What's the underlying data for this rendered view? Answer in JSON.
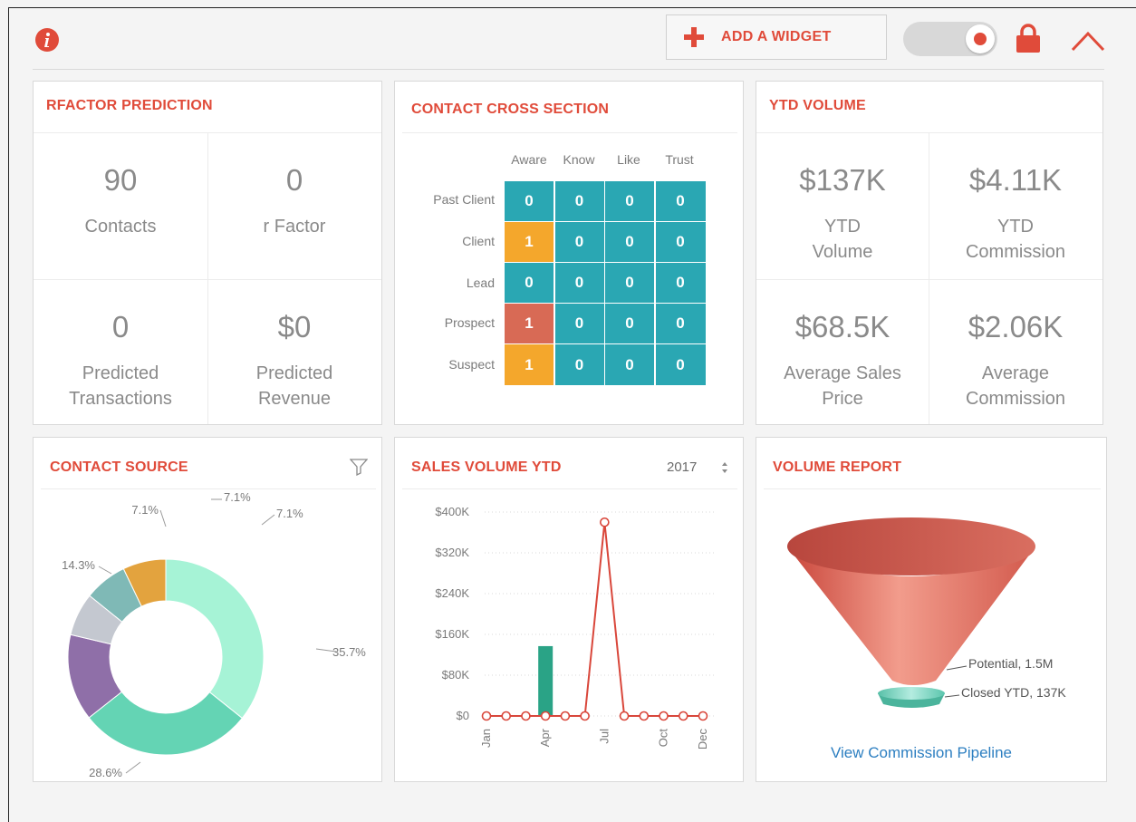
{
  "toolbar": {
    "add_widget_label": "ADD A WIDGET"
  },
  "colors": {
    "accent": "#e04b3a",
    "teal": "#2aa7b3",
    "orange": "#f4a72c",
    "salmon": "#d86a55",
    "link": "#2d7fc1"
  },
  "rfactor": {
    "title": "RFACTOR PREDICTION",
    "stats": [
      {
        "value": "90",
        "label": "Contacts"
      },
      {
        "value": "0",
        "label": "r Factor"
      },
      {
        "value": "0",
        "label": "Predicted Transactions"
      },
      {
        "value": "$0",
        "label": "Predicted Revenue"
      }
    ]
  },
  "cross": {
    "title": "CONTACT CROSS SECTION",
    "columns": [
      "Aware",
      "Know",
      "Like",
      "Trust"
    ],
    "rows": [
      {
        "label": "Past Client",
        "values": [
          "0",
          "0",
          "0",
          "0"
        ],
        "first_color": "teal"
      },
      {
        "label": "Client",
        "values": [
          "1",
          "0",
          "0",
          "0"
        ],
        "first_color": "orange"
      },
      {
        "label": "Lead",
        "values": [
          "0",
          "0",
          "0",
          "0"
        ],
        "first_color": "teal"
      },
      {
        "label": "Prospect",
        "values": [
          "1",
          "0",
          "0",
          "0"
        ],
        "first_color": "salmon"
      },
      {
        "label": "Suspect",
        "values": [
          "1",
          "0",
          "0",
          "0"
        ],
        "first_color": "orange"
      }
    ]
  },
  "ytd": {
    "title": "YTD VOLUME",
    "stats": [
      {
        "value": "$137K",
        "label": "YTD Volume"
      },
      {
        "value": "$4.11K",
        "label": "YTD Commission"
      },
      {
        "value": "$68.5K",
        "label": "Average Sales Price"
      },
      {
        "value": "$2.06K",
        "label": "Average Commission"
      }
    ]
  },
  "source": {
    "title": "CONTACT SOURCE",
    "filter_icon": "filter-icon"
  },
  "sales": {
    "title": "SALES VOLUME YTD",
    "year": "2017",
    "sort_icon": "updown-icon"
  },
  "volume": {
    "title": "VOLUME REPORT",
    "link": "View Commission Pipeline"
  },
  "chart_data": [
    {
      "type": "pie",
      "donut": true,
      "slices": [
        {
          "value": 35.7,
          "label": "35.7%",
          "color": "#a6f3d6"
        },
        {
          "value": 28.6,
          "label": "28.6%",
          "color": "#64d4b4"
        },
        {
          "value": 14.3,
          "label": "14.3%",
          "color": "#8f6fa8"
        },
        {
          "value": 7.1,
          "label": "7.1%",
          "color": "#c4c8d0"
        },
        {
          "value": 7.1,
          "label": "7.1%",
          "color": "#7fb9b6"
        },
        {
          "value": 7.1,
          "label": "7.1%",
          "color": "#e3a33e"
        }
      ]
    },
    {
      "type": "line",
      "categories": [
        "Jan",
        "Feb",
        "Mar",
        "Apr",
        "May",
        "Jun",
        "Jul",
        "Aug",
        "Sep",
        "Oct",
        "Nov",
        "Dec"
      ],
      "x_tick_labels": [
        "Jan",
        "Apr",
        "Jul",
        "Oct",
        "Dec"
      ],
      "y_tick_labels": [
        "$0",
        "$80K",
        "$160K",
        "$240K",
        "$320K",
        "$400K"
      ],
      "ylim": [
        0,
        400000
      ],
      "grid": true,
      "series": [
        {
          "kind": "bar",
          "values": [
            0,
            0,
            0,
            137000,
            0,
            0,
            0,
            0,
            0,
            0,
            0,
            0
          ],
          "color": "#2aa386"
        },
        {
          "kind": "line",
          "values": [
            0,
            0,
            0,
            0,
            0,
            0,
            380000,
            0,
            0,
            0,
            0,
            0
          ],
          "color": "#d9473b"
        }
      ]
    },
    {
      "type": "funnel",
      "stages": [
        {
          "label": "Potential, 1.5M",
          "value": 1500000
        },
        {
          "label": "Closed YTD, 137K",
          "value": 137000
        }
      ]
    }
  ]
}
